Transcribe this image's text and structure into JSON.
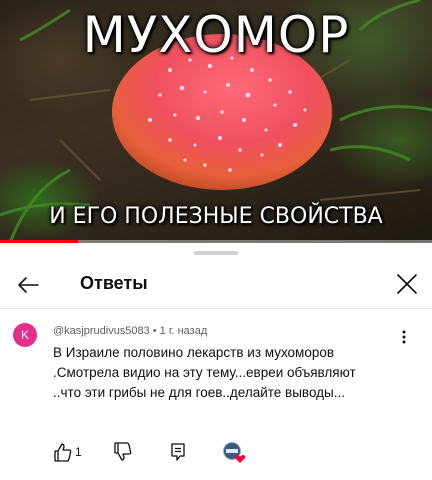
{
  "video": {
    "title_top": "МУХОМОР",
    "title_bottom": "И ЕГО ПОЛЕЗНЫЕ СВОЙСТВА",
    "progress_fraction": 0.18
  },
  "panel": {
    "title": "Ответы",
    "back_icon": "arrow-left-icon",
    "close_icon": "close-icon"
  },
  "comment": {
    "avatar_letter": "K",
    "avatar_color": "#e62e8b",
    "author": "@kasjprudivus5083",
    "separator": "•",
    "time": "1 г. назад",
    "text": "В Израиле половино лекарств из мухоморов .Смотрела видио на эту тему...евреи объявляют ..что эти грибы не для гоев..делайте выводы...",
    "likes": "1"
  },
  "colors": {
    "accent": "#ff0000",
    "heart": "#ff0033"
  }
}
